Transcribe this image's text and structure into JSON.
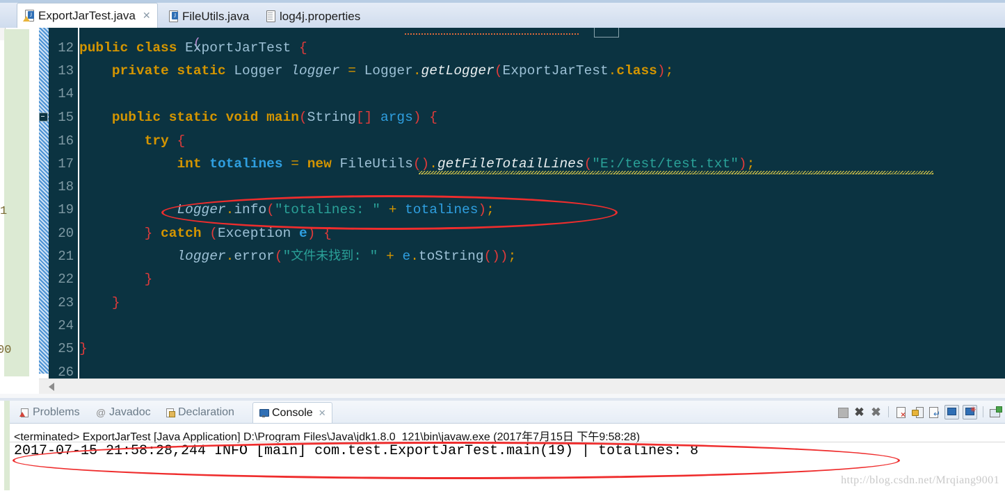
{
  "editor_tabs": [
    {
      "label": "ExportJarTest.java",
      "icon": "java-file-warning-icon",
      "active": true,
      "closable": true,
      "close_glyph": "✕"
    },
    {
      "label": "FileUtils.java",
      "icon": "java-file-icon",
      "active": false,
      "closable": false,
      "close_glyph": ""
    },
    {
      "label": "log4j.properties",
      "icon": "properties-file-icon",
      "active": false,
      "closable": false,
      "close_glyph": ""
    }
  ],
  "editor": {
    "line_numbers": [
      "12",
      "13",
      "14",
      "15",
      "16",
      "17",
      "18",
      "19",
      "20",
      "21",
      "22",
      "23",
      "24",
      "25",
      "26"
    ],
    "lines": [
      {
        "num": "12",
        "text": "public class ExportJarTest {"
      },
      {
        "num": "13",
        "text": "    private static Logger logger = Logger.getLogger(ExportJarTest.class);"
      },
      {
        "num": "14",
        "text": ""
      },
      {
        "num": "15",
        "text": "    public static void main(String[] args) {"
      },
      {
        "num": "16",
        "text": "        try {"
      },
      {
        "num": "17",
        "text": "            int totalines = new FileUtils().getFileTotailLines(\"E:/test/test.txt\");"
      },
      {
        "num": "18",
        "text": ""
      },
      {
        "num": "19",
        "text": "            Logger.info(\"totalines: \" + totalines);"
      },
      {
        "num": "20",
        "text": "        } catch (Exception e) {"
      },
      {
        "num": "21",
        "text": "            logger.error(\"文件未找到: \" + e.toString());"
      },
      {
        "num": "22",
        "text": "        }"
      },
      {
        "num": "23",
        "text": "    }"
      },
      {
        "num": "24",
        "text": ""
      },
      {
        "num": "25",
        "text": "}"
      },
      {
        "num": "26",
        "text": ""
      }
    ],
    "tokens": {
      "kw_public": "public",
      "kw_class": "class",
      "kw_private": "private",
      "kw_static": "static",
      "kw_void": "void",
      "kw_new": "new",
      "kw_try": "try",
      "kw_catch": "catch",
      "kw_int": "int",
      "kw_class_literal": "class",
      "type_ExportJarTest": "ExportJarTest",
      "type_Logger": "Logger",
      "type_String": "String",
      "type_FileUtils": "FileUtils",
      "type_Exception": "Exception",
      "field_logger": "logger",
      "method_getLogger": "getLogger",
      "method_getFileTotailLines": "getFileTotailLines",
      "method_main": "main",
      "method_info": "info",
      "method_error": "error",
      "method_toString": "toString",
      "local_totalines": "totalines",
      "local_args": "args",
      "local_e": "e",
      "str_path": "\"E:/test/test.txt\"",
      "str_totalines": "\"totalines: \"",
      "str_chinese": "\"文件未找到: \""
    },
    "markers": {
      "fold_line": "15",
      "warning_line": "17",
      "warning_icon": "warning-bulb-icon"
    },
    "scrollbar": {
      "left_arrow": "◀"
    }
  },
  "bottom_panel": {
    "tabs": [
      {
        "label": "Problems",
        "icon": "problems-icon",
        "active": false,
        "closable": false,
        "close_glyph": ""
      },
      {
        "label": "Javadoc",
        "icon": "javadoc-icon",
        "active": false,
        "closable": false,
        "close_glyph": ""
      },
      {
        "label": "Declaration",
        "icon": "declaration-icon",
        "active": false,
        "closable": false,
        "close_glyph": ""
      },
      {
        "label": "Console",
        "icon": "console-icon",
        "active": true,
        "closable": true,
        "close_glyph": "✕"
      }
    ],
    "toolbar": [
      {
        "name": "terminate-button",
        "glyph": "■"
      },
      {
        "name": "remove-launch-button",
        "glyph": "✖"
      },
      {
        "name": "remove-all-terminated-button",
        "glyph": "✖"
      },
      {
        "name": "clear-console-button",
        "glyph": ""
      },
      {
        "name": "scroll-lock-button",
        "glyph": ""
      },
      {
        "name": "word-wrap-button",
        "glyph": ""
      },
      {
        "name": "show-console-on-output-button",
        "glyph": ""
      },
      {
        "name": "display-selected-console-button",
        "glyph": ""
      },
      {
        "name": "open-console-button",
        "glyph": ""
      }
    ],
    "console_output": {
      "terminated_line": "<terminated> ExportJarTest [Java Application] D:\\Program Files\\Java\\jdk1.8.0_121\\bin\\javaw.exe (2017年7月15日 下午9:58:28)",
      "log_line": "2017-07-15 21:58:28,244 INFO [main] com.test.ExportJarTest.main(19) | totalines: 8"
    }
  },
  "watermark": "http://blog.csdn.net/Mrqiang9001",
  "annotations": {
    "ellipse_code_line": "19",
    "ellipse_console_line": "log_line",
    "ellipse_color": "#ef2d2d"
  },
  "background_ghost": {
    "left_fragment_1": "1",
    "left_fragment_2": "00"
  },
  "colors": {
    "editor_bg": "#0b3341",
    "keyword": "#d49500",
    "type": "#9dc1d6",
    "string": "#2aa198",
    "local_var": "#2f9fe0",
    "punct_red": "#e03b3b",
    "line_number": "#7f9aa4",
    "annotation_red": "#ef2d2d"
  }
}
